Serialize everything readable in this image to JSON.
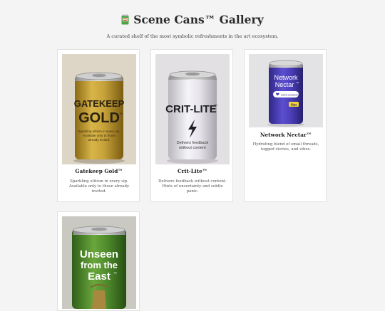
{
  "header": {
    "icon": "soda-can-icon",
    "title": "Scene Cans™ Gallery",
    "subtitle": "A curated shelf of the most symbolic refreshments in the art ecosystem."
  },
  "cards": [
    {
      "name": "Gatekeep Gold™",
      "description": "Sparkling elitism in every sip. Available only to those already invited.",
      "can": {
        "label_lines": [
          "GATEKEEP",
          "GOLD"
        ],
        "tm": "™",
        "small_text": [
          "Sparkling elitism in every sip.",
          "Available only to those",
          "already invited."
        ],
        "color": "#b8962e"
      }
    },
    {
      "name": "Crit-Lite™",
      "description": "Delivers feedback without content. Hints of uncertainty and subtle panic.",
      "can": {
        "label_lines": [
          "CRIT-LITE"
        ],
        "tm": "™",
        "small_text": [
          "Delivers feedback",
          "without content"
        ],
        "color": "#e9e7ee"
      }
    },
    {
      "name": "Network Nectar™",
      "description": "Hydrating blend of email threads, tagged stories, and vibes.",
      "can": {
        "label_lines": [
          "Network",
          "Nectar"
        ],
        "tm": "™",
        "badge": "Let's connect!",
        "tag": "Sips",
        "color": "#4a3db5"
      }
    },
    {
      "name": "",
      "description": "",
      "can": {
        "label_lines": [
          "Unseen",
          "from the",
          "East"
        ],
        "tm": "™",
        "color": "#4c8a2c"
      }
    }
  ]
}
